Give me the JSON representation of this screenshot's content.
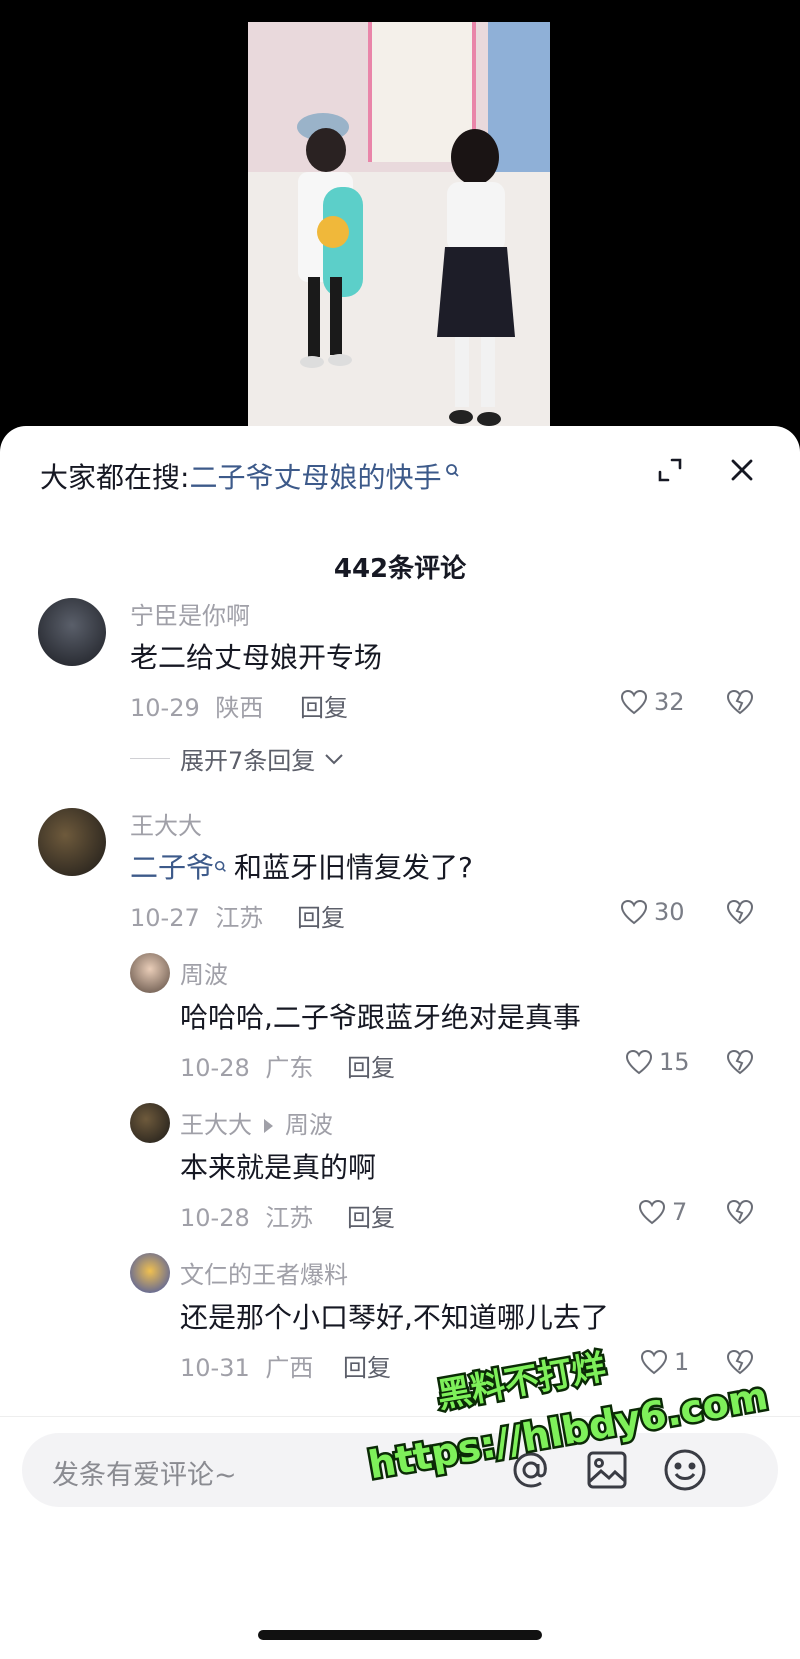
{
  "search": {
    "prefix": "大家都在搜:",
    "query": "二子爷丈母娘的快手"
  },
  "comment_count": "442条评论",
  "comments": [
    {
      "user": "宁臣是你啊",
      "text": "老二给丈母娘开专场",
      "date": "10-29",
      "region": "陕西",
      "reply_label": "回复",
      "likes": "32",
      "expand": "展开7条回复"
    },
    {
      "user": "王大大",
      "mention": "二子爷",
      "text": "和蓝牙旧情复发了?",
      "date": "10-27",
      "region": "江苏",
      "reply_label": "回复",
      "likes": "30"
    }
  ],
  "replies": [
    {
      "user": "周波",
      "text": "哈哈哈,二子爷跟蓝牙绝对是真事",
      "date": "10-28",
      "region": "广东",
      "reply_label": "回复",
      "likes": "15"
    },
    {
      "user": "王大大",
      "reply_to": "周波",
      "text": "本来就是真的啊",
      "date": "10-28",
      "region": "江苏",
      "reply_label": "回复",
      "likes": "7"
    },
    {
      "user": "文仁的王者爆料",
      "text": "还是那个小口琴好,不知道哪儿去了",
      "date": "10-31",
      "region": "广西",
      "reply_label": "回复",
      "likes": "1"
    }
  ],
  "watermark": {
    "line1": "黑料不打烊",
    "line2": "https://hlbdy6.com"
  },
  "input": {
    "placeholder": "发条有爱评论~"
  },
  "colors": {
    "link": "#3d5a8a",
    "watermark_fill": "#7ef05a"
  }
}
